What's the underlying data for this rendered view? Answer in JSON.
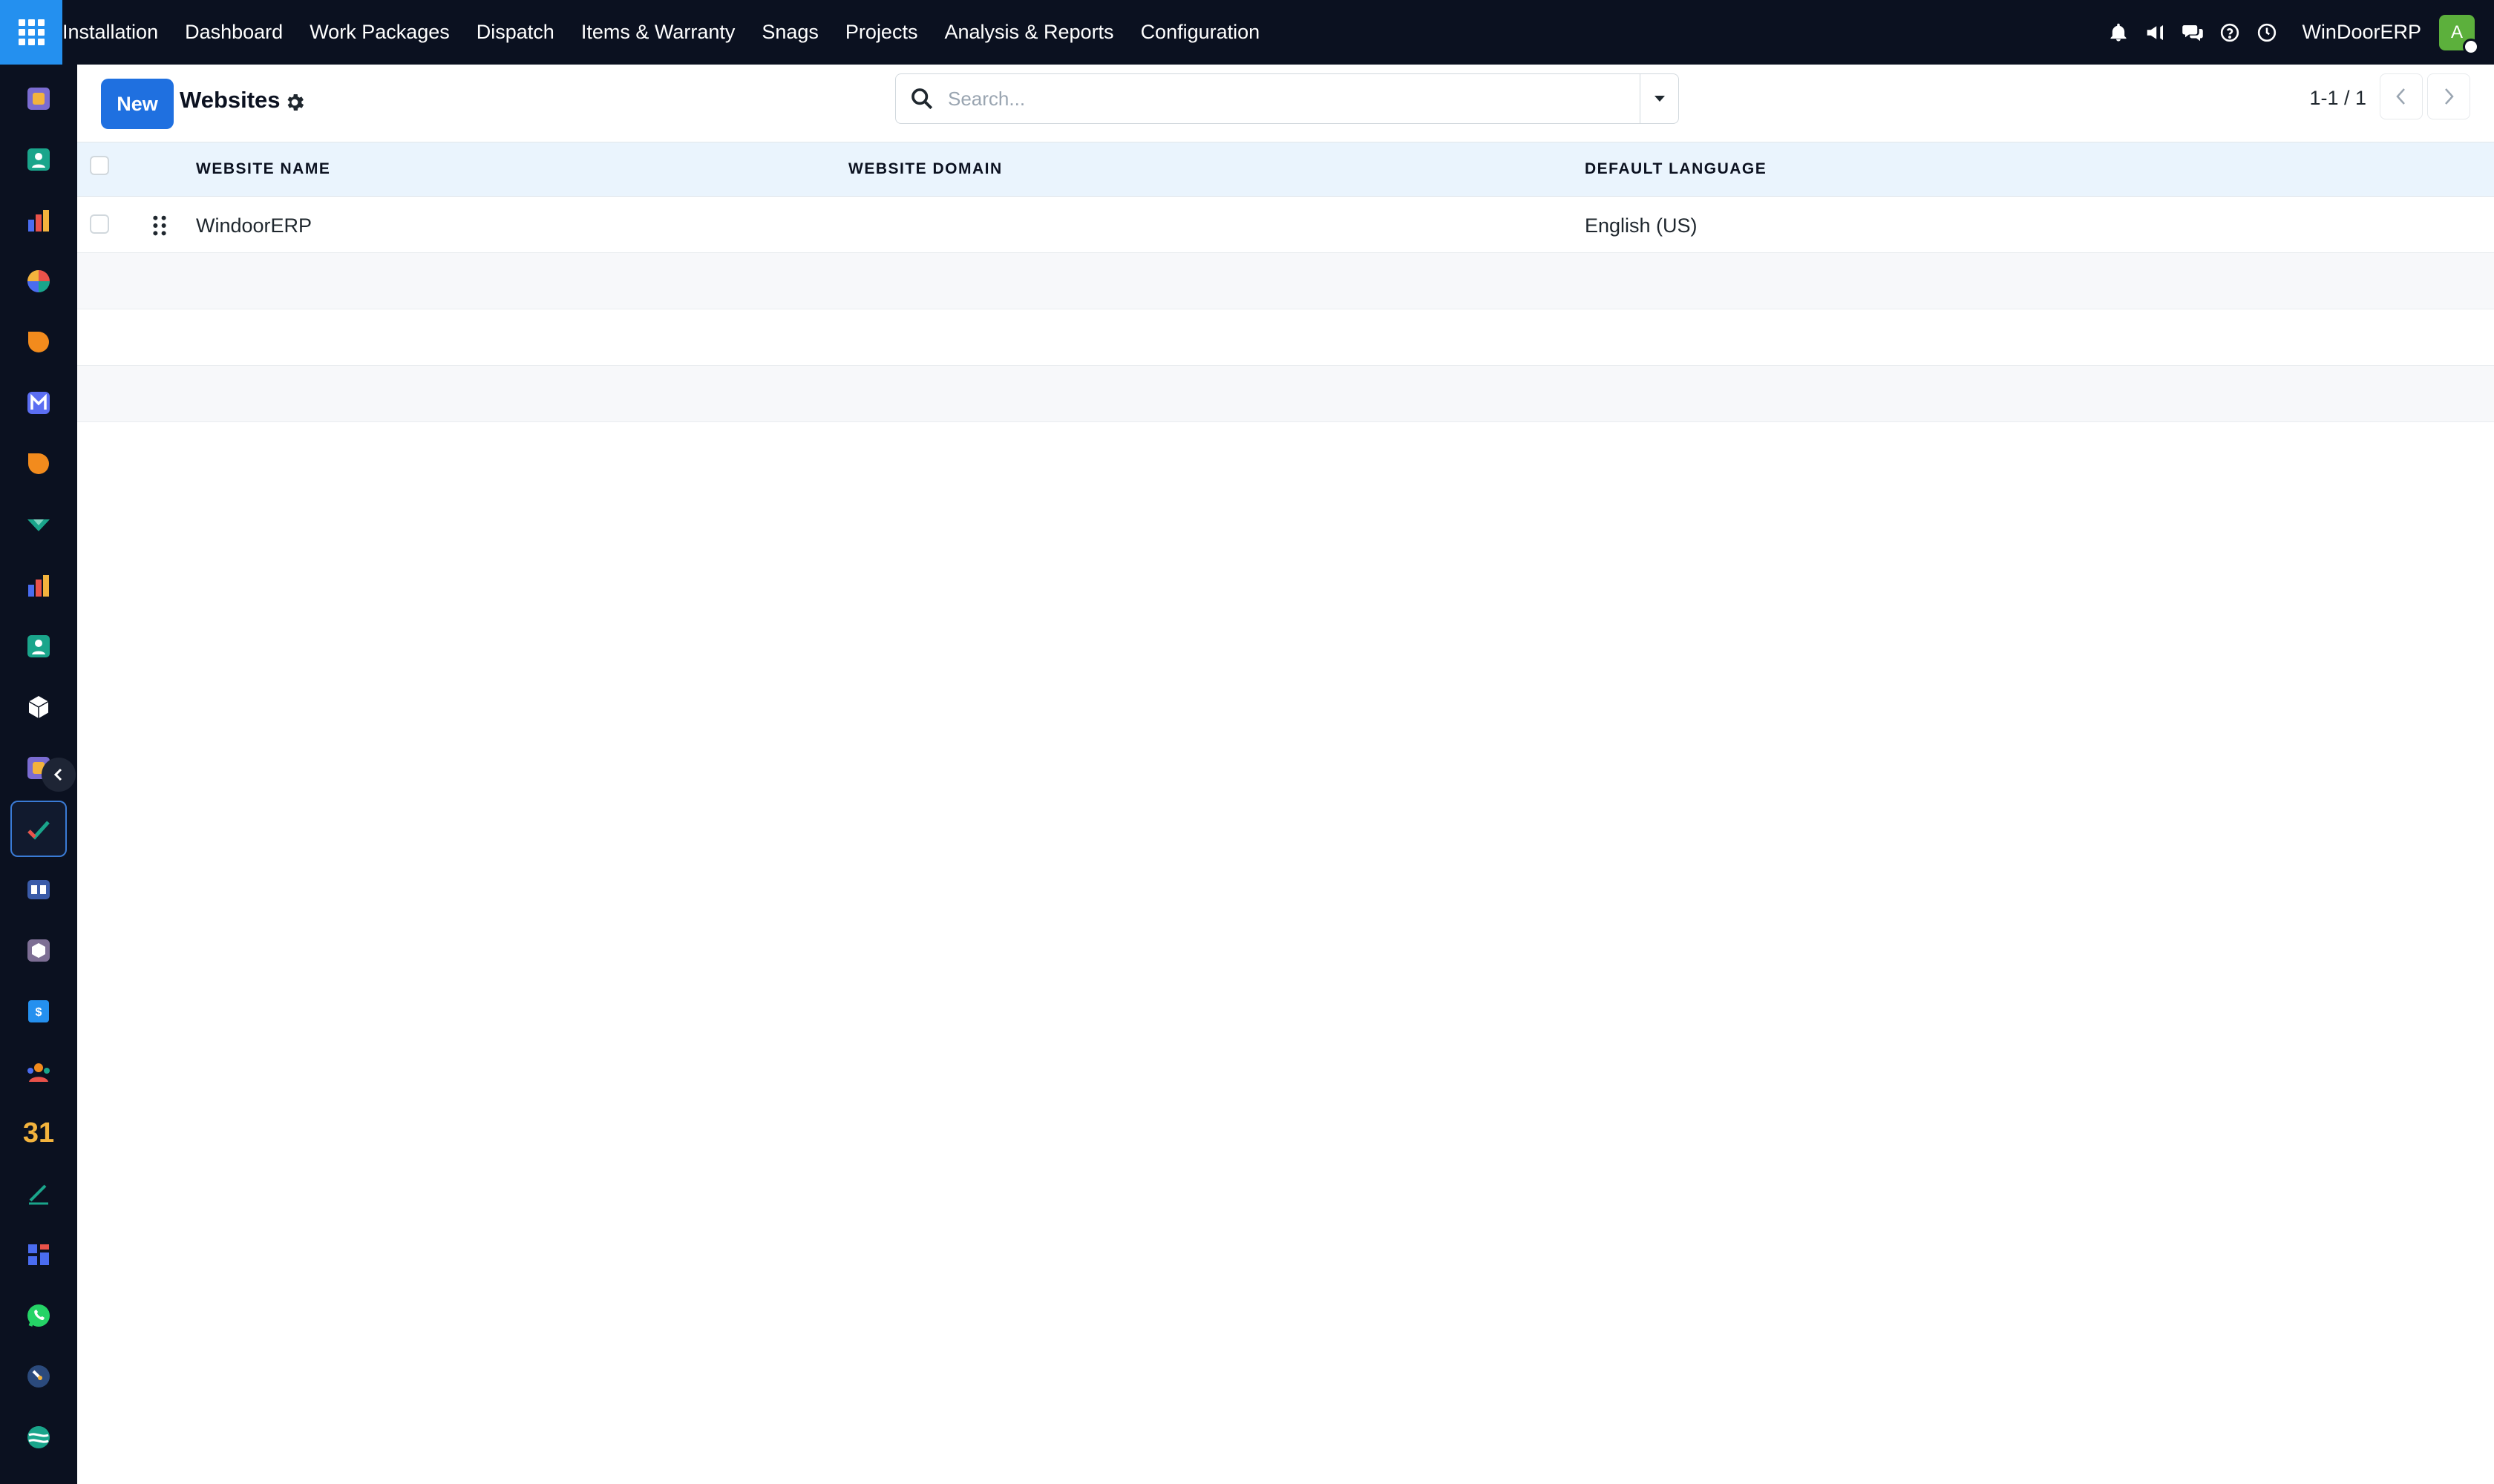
{
  "nav": {
    "menu": [
      "Installation",
      "Dashboard",
      "Work Packages",
      "Dispatch",
      "Items & Warranty",
      "Snags",
      "Projects",
      "Analysis & Reports",
      "Configuration"
    ],
    "brand": "WinDoorERP",
    "avatar_initial": "A",
    "icons": [
      "bell-icon",
      "megaphone-icon",
      "chat-icon",
      "help-icon",
      "clock-icon"
    ]
  },
  "rail": {
    "items": [
      "app-icon-1",
      "app-icon-2",
      "app-icon-3",
      "app-icon-4",
      "app-icon-5",
      "app-icon-6",
      "app-icon-7",
      "app-icon-8",
      "app-icon-9",
      "app-icon-10",
      "app-icon-11",
      "app-icon-12",
      "app-icon-13",
      "app-icon-14",
      "app-icon-15",
      "app-icon-16",
      "app-icon-17",
      "calendar-icon",
      "app-icon-19",
      "app-icon-20",
      "whatsapp-icon",
      "app-icon-22",
      "app-icon-23"
    ],
    "active_index": 12,
    "calendar_label": "31"
  },
  "page": {
    "new_label": "New",
    "title": "Websites",
    "search_placeholder": "Search...",
    "pager_text": "1-1 / 1"
  },
  "table": {
    "columns": [
      "WEBSITE NAME",
      "WEBSITE DOMAIN",
      "DEFAULT LANGUAGE"
    ],
    "rows": [
      {
        "name": "WindoorERP",
        "domain": "",
        "language": "English (US)"
      }
    ]
  },
  "colors": {
    "nav_bg": "#0b1120",
    "accent": "#1f70e0",
    "apps_button": "#2490ef",
    "header_row": "#eaf4fd",
    "avatar": "#5cb03c"
  }
}
